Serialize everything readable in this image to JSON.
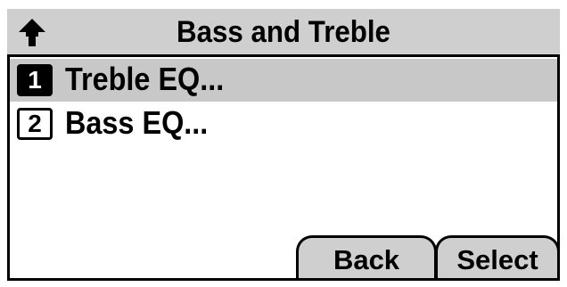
{
  "title": "Bass and Treble",
  "title_icon": "home-icon",
  "menu": [
    {
      "number": "1",
      "label": "Treble EQ...",
      "selected": true
    },
    {
      "number": "2",
      "label": "Bass EQ...",
      "selected": false
    }
  ],
  "softkeys": {
    "back": "Back",
    "select": "Select"
  }
}
